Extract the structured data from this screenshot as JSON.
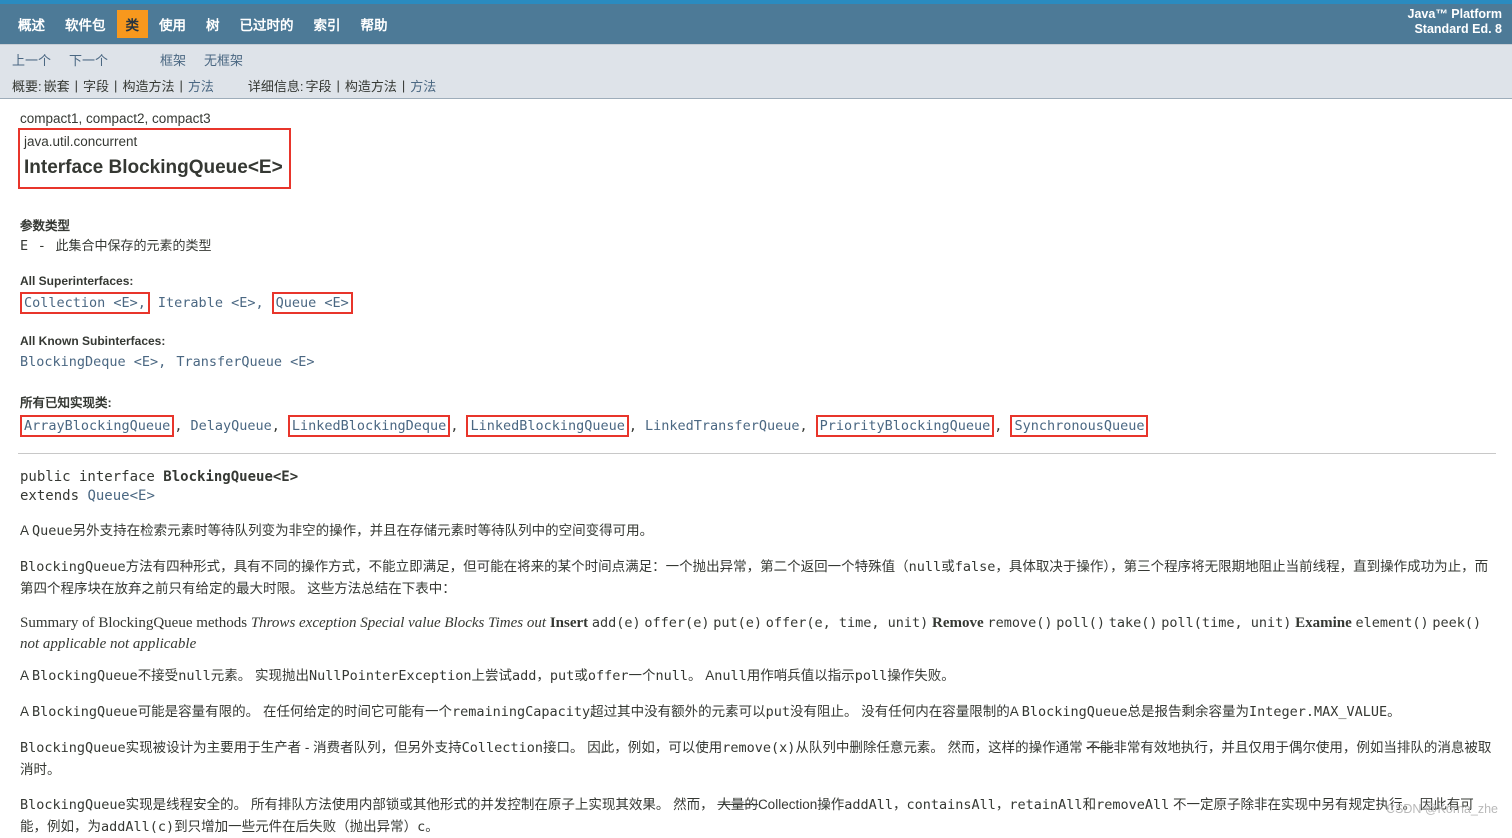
{
  "navbar": {
    "items": [
      {
        "label": "概述",
        "active": false
      },
      {
        "label": "软件包",
        "active": false
      },
      {
        "label": "类",
        "active": true
      },
      {
        "label": "使用",
        "active": false
      },
      {
        "label": "树",
        "active": false
      },
      {
        "label": "已过时的",
        "active": false
      },
      {
        "label": "索引",
        "active": false
      },
      {
        "label": "帮助",
        "active": false
      }
    ],
    "brand_line1": "Java™ Platform",
    "brand_line2": "Standard Ed. 8",
    "accent_color": "#f8981d",
    "bar_color": "#4d7a97",
    "top_strip_color": "#2a8bc0"
  },
  "subnav": {
    "prev": "上一个",
    "next": "下一个",
    "frames": "框架",
    "no_frames": "无框架",
    "summary_label": "概要:",
    "summary_items": [
      "嵌套",
      "字段",
      "构造方法",
      "方法"
    ],
    "detail_label": "详细信息:",
    "detail_items": [
      "字段",
      "构造方法",
      "方法"
    ]
  },
  "header": {
    "profiles": "compact1, compact2, compact3",
    "package": "java.util.concurrent",
    "title": "Interface BlockingQueue<E>"
  },
  "type_params": {
    "heading": "参数类型",
    "name": "E",
    "dash": "-",
    "description": "此集合中保存的元素的类型"
  },
  "superinterfaces": {
    "heading": "All Superinterfaces:",
    "items": [
      {
        "text": "Collection <E>,",
        "boxed": true
      },
      {
        "text": "Iterable <E>,",
        "boxed": false
      },
      {
        "text": "Queue <E>",
        "boxed": true
      }
    ]
  },
  "subinterfaces": {
    "heading": "All Known Subinterfaces:",
    "items": [
      {
        "text": "BlockingDeque <E>,",
        "boxed": false
      },
      {
        "text": "TransferQueue <E>",
        "boxed": false
      }
    ]
  },
  "implementing": {
    "heading": "所有已知实现类:",
    "items": [
      {
        "text": "ArrayBlockingQueue",
        "boxed": true,
        "sep": ","
      },
      {
        "text": "DelayQueue",
        "boxed": false,
        "sep": ","
      },
      {
        "text": "LinkedBlockingDeque",
        "boxed": true,
        "sep": ","
      },
      {
        "text": "LinkedBlockingQueue",
        "boxed": true,
        "sep": ","
      },
      {
        "text": "LinkedTransferQueue",
        "boxed": false,
        "sep": ","
      },
      {
        "text": "PriorityBlockingQueue",
        "boxed": true,
        "sep": ","
      },
      {
        "text": "SynchronousQueue",
        "boxed": true,
        "sep": ""
      }
    ]
  },
  "declaration": {
    "line1_prefix": "public interface ",
    "line1_name": "BlockingQueue<E>",
    "line2_prefix": "extends ",
    "line2_link": "Queue<E>"
  },
  "paragraphs": {
    "p1_a": "A ",
    "p1_code": "Queue",
    "p1_b": "另外支持在检索元素时等待队列变为非空的操作，并且在存储元素时等待队列中的空间变得可用。",
    "p2_code1": "BlockingQueue",
    "p2_a": "方法有四种形式，具有不同的操作方式，不能立即满足，但可能在将来的某个时间点满足：一个抛出异常，第二个返回一个特殊值（",
    "p2_code2": "null",
    "p2_b": "或",
    "p2_code3": "false",
    "p2_c": "，具体取决于操作），第三个程序将无限期地阻止当前线程，直到操作成功为止，而第四个程序块在放弃之前只有给定的最大时限。 这些方法总结在下表中：",
    "p4_a": "A ",
    "p4_code1": "BlockingQueue",
    "p4_b": "不接受",
    "p4_code2": "null",
    "p4_c": "元素。 实现抛出",
    "p4_code3": "NullPointerException",
    "p4_d": "上尝试",
    "p4_code4": "add",
    "p4_e": "，",
    "p4_code5": "put",
    "p4_f": "或",
    "p4_code6": "offer",
    "p4_g": "一个",
    "p4_code7": "null",
    "p4_h": "。 A",
    "p4_code8": "null",
    "p4_i": "用作哨兵值以指示",
    "p4_code9": "poll",
    "p4_j": "操作失败。",
    "p5_a": "A ",
    "p5_code1": "BlockingQueue",
    "p5_b": "可能是容量有限的。 在任何给定的时间它可能有一个",
    "p5_code2": "remainingCapacity",
    "p5_c": "超过其中没有额外的元素可以",
    "p5_code3": "put",
    "p5_d": "没有阻止。 没有任何内在容量限制的A ",
    "p5_code4": "BlockingQueue",
    "p5_e": "总是报告剩余容量为",
    "p5_code5": "Integer.MAX_VALUE",
    "p5_f": "。",
    "p6_code1": "BlockingQueue",
    "p6_a": "实现被设计为主要用于生产者 - 消费者队列，但另外支持",
    "p6_code2": "Collection",
    "p6_b": "接口。 因此，例如，可以使用",
    "p6_code3": "remove(x)",
    "p6_c": "从队列中删除任意元素。 然而，这样的操作通常 ",
    "p6_strike": "不能",
    "p6_d": "非常有效地执行，并且仅用于偶尔使用，例如当排队的消息被取消时。",
    "p7_code1": "BlockingQueue",
    "p7_a": "实现是线程安全的。 所有排队方法使用内部锁或其他形式的并发控制在原子上实现其效果。 然而， ",
    "p7_strike": "大量的",
    "p7_b": "Collection操作",
    "p7_code2": "addAll",
    "p7_c": "，",
    "p7_code3": "containsAll",
    "p7_d": "，",
    "p7_code4": "retainAll",
    "p7_e": "和",
    "p7_code5": "removeAll",
    "p7_f": " 不一定原子除非在实现中另有规定执行。 因此有可能，例如，为",
    "p7_code6": "addAll(c)",
    "p7_g": "到只增加一些元件在后失败（抛出异常）",
    "p7_code7": "c",
    "p7_h": "。"
  },
  "summary_table_text": {
    "title": "Summary of BlockingQueue methods",
    "h_throws": "Throws exception",
    "h_special": "Special value",
    "h_blocks": "Blocks",
    "h_times": "Times out",
    "r_insert": "Insert",
    "insert_1": "add(e)",
    "insert_2": "offer(e)",
    "insert_3": "put(e)",
    "insert_4": "offer(e, time, unit)",
    "r_remove": "Remove",
    "remove_1": "remove()",
    "remove_2": "poll()",
    "remove_3": "take()",
    "remove_4": "poll(time, unit)",
    "r_examine": "Examine",
    "examine_1": "element()",
    "examine_2": "peek()",
    "examine_3": "not applicable",
    "examine_4": "not applicable"
  },
  "watermark": "CSDN @Korna_zhe"
}
